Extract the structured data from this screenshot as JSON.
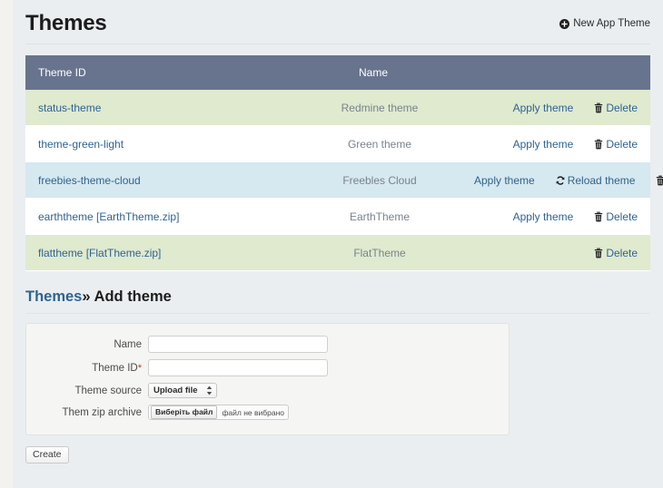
{
  "header": {
    "title": "Themes",
    "new_theme_label": "New App Theme",
    "new_theme_icon": "plus-circle-icon"
  },
  "table": {
    "columns": [
      "Theme ID",
      "Name",
      ""
    ],
    "actions": {
      "apply_label": "Apply theme",
      "reload_label": "Reload theme",
      "delete_label": "Delete",
      "reload_icon": "refresh-icon",
      "delete_icon": "trash-icon"
    },
    "rows": [
      {
        "id": "status-theme",
        "name": "Redmine theme",
        "row_style": "row-green",
        "has_apply": true,
        "has_reload": false,
        "has_delete": true
      },
      {
        "id": "theme-green-light",
        "name": "Green theme",
        "row_style": "row-white",
        "has_apply": true,
        "has_reload": false,
        "has_delete": true
      },
      {
        "id": "freebies-theme-cloud",
        "name": "Freebles Cloud",
        "row_style": "row-blue",
        "has_apply": true,
        "has_reload": true,
        "has_delete": true
      },
      {
        "id": "earththeme [EarthTheme.zip]",
        "name": "EarthTheme",
        "row_style": "row-white",
        "has_apply": true,
        "has_reload": false,
        "has_delete": true
      },
      {
        "id": "flattheme [FlatTheme.zip]",
        "name": "FlatTheme",
        "row_style": "row-green",
        "has_apply": false,
        "has_reload": false,
        "has_delete": true
      }
    ]
  },
  "subheading": {
    "link": "Themes",
    "separator": "»",
    "current": "Add theme"
  },
  "form": {
    "name_label": "Name",
    "name_value": "",
    "name_placeholder": "",
    "theme_id_label": "Theme ID",
    "theme_id_required_mark": "*",
    "theme_id_value": "",
    "theme_id_placeholder": "",
    "theme_source_label": "Theme source",
    "theme_source_selected": "Upload file",
    "theme_source_options": [
      "Upload file"
    ],
    "zip_label": "Them zip archive",
    "file_button_label": "Виберіть файл",
    "file_status_text": "файл не вибрано",
    "submit_label": "Create"
  },
  "colors": {
    "page_background": "#eaeef1",
    "table_header": "#68748e",
    "row_green": "#dfeacf",
    "row_blue": "#d6e8f0",
    "row_white": "#ffffff",
    "link_blue": "#2f6392",
    "muted_text": "#79838b",
    "required_red": "#c0392b"
  }
}
